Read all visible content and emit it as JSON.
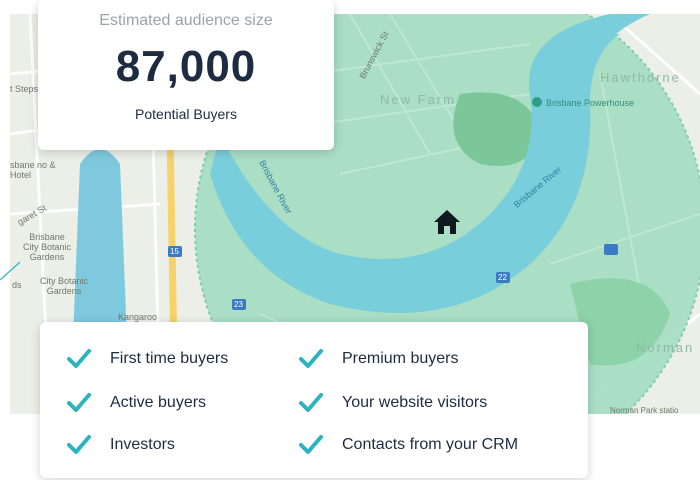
{
  "audience": {
    "title": "Estimated audience size",
    "count": "87,000",
    "subtitle": "Potential Buyers"
  },
  "features": [
    "First time buyers",
    "Premium buyers",
    "Active buyers",
    "Your website visitors",
    "Investors",
    "Contacts from your CRM"
  ],
  "map": {
    "labels": {
      "new_farm": "New Farm",
      "hawthorne": "Hawthorne",
      "norman": "Norman",
      "powerhouse": "Brisbane Powerhouse",
      "botanic": "Brisbane City Botanic Gardens",
      "botanic2": "City Botanic Gardens",
      "kangaroo": "Kangaroo",
      "river1": "Brisbane River",
      "river2": "Brisbane River",
      "steps": "t Steps",
      "hotel": "sbane no & Hotel",
      "norman_park": "Norman Park statio",
      "brunswick": "Brunswick St",
      "margaret": "garet St",
      "ds": "ds",
      "route15": "15",
      "route23": "23",
      "route22": "22"
    }
  },
  "colors": {
    "navy": "#1d2c40",
    "teal_check": "#2bb3c0",
    "radius_fill": "#8fd9ba",
    "river": "#7fd0dc"
  }
}
